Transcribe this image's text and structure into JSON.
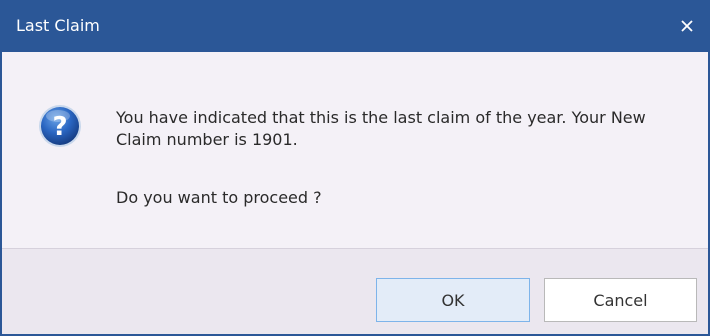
{
  "dialog": {
    "title": "Last Claim",
    "close_icon": "close-icon",
    "icon": "question-icon",
    "icon_glyph": "?",
    "message": "You have indicated that this is the last claim of the year. Your New Claim number is 1901.",
    "prompt": "Do you want to proceed ?",
    "buttons": {
      "ok_label": "OK",
      "cancel_label": "Cancel"
    }
  },
  "colors": {
    "titlebar": "#2b5797",
    "content_bg": "#f4f1f7",
    "footer_bg": "#ebe7ef",
    "ok_button_border": "#7eb4ea",
    "ok_button_bg": "#e3ecf8"
  }
}
